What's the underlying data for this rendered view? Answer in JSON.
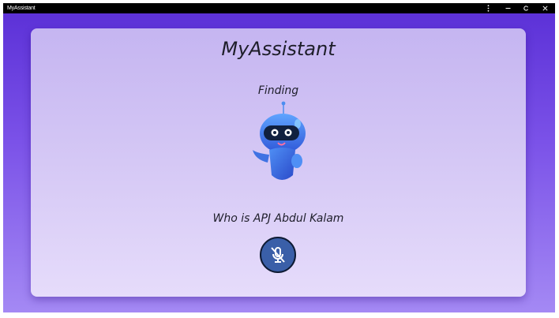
{
  "window": {
    "title": "MyAssistant",
    "controls": {
      "menu_icon": "more-vertical-icon",
      "minimize_glyph": "–",
      "maximize_icon": "restore-icon",
      "close_glyph": "✕"
    }
  },
  "main": {
    "heading": "MyAssistant",
    "status": "Finding",
    "illustration_icon": "robot-icon",
    "query": "Who is APJ Abdul Kalam",
    "mic_button_icon": "microphone-off-icon"
  },
  "colors": {
    "window_gradient_top": "#5a2fd6",
    "window_gradient_bottom": "#a489f4",
    "card_top": "#c5b5f1",
    "card_bottom": "#e6dcfb",
    "mic_button": "#3a5fa8",
    "titlebar": "#000000"
  }
}
